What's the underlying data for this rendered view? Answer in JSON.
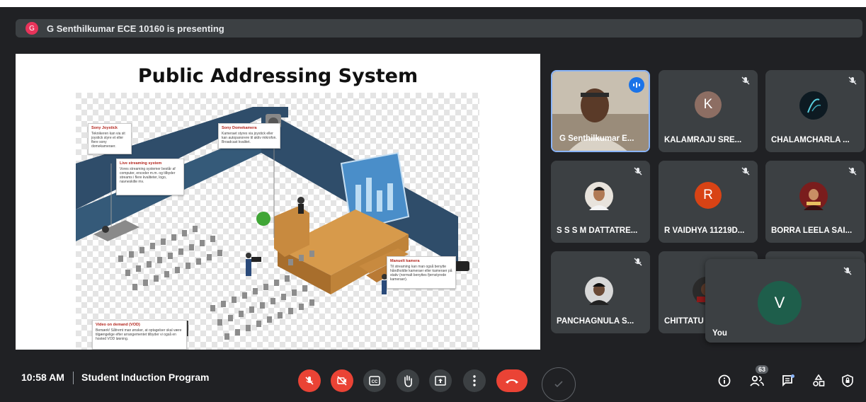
{
  "presenting_banner": {
    "avatar_letter": "G",
    "text": "G Senthilkumar ECE 10160 is presenting"
  },
  "slide": {
    "title": "Public Addressing System",
    "callouts": [
      {
        "title": "Sony Joystick",
        "body": "Teknikeren kan via sit joystick styre et eller flere sony domekameraer."
      },
      {
        "title": "Sony Domekamera",
        "body": "Kameraet styres via joystick eller kan autopanorere til aktiv mikrofon. Broadcast kvalitet."
      },
      {
        "title": "Live streaming system",
        "body": "Vores streaming systemer består af computer, encoder m.m. og tilbyder streams i flere kvaliteter, logo, navneskilte mv."
      },
      {
        "title": "Manuelt kamera",
        "body": "Til streaming kan man også benytte håndholdte kameraer eller kameraer på stativ (normalt benyttes fjernstyrede kameraer)."
      },
      {
        "title": "Video on demand (VOD)",
        "body": "Bemærk! Såfremt man ønsker, at optagelser skal være tilgængelige efter arrangementet tilbyder vi også en hosted VOD løsning."
      }
    ]
  },
  "participants": [
    {
      "name": "G Senthilkumar E...",
      "kind": "video",
      "speaking": true
    },
    {
      "name": "KALAMRAJU SRE...",
      "avatar_letter": "K",
      "avatar_color": "#8d6e63"
    },
    {
      "name": "CHALAMCHARLA ...",
      "kind": "photo"
    },
    {
      "name": "S S S M DATTATRE...",
      "kind": "photo"
    },
    {
      "name": "R VAIDHYA 11219D...",
      "avatar_letter": "R",
      "avatar_color": "#d84315"
    },
    {
      "name": "BORRA LEELA SAI...",
      "kind": "photo"
    },
    {
      "name": "PANCHAGNULA S...",
      "kind": "photo"
    },
    {
      "name": "CHITTATU",
      "kind": "photo"
    }
  ],
  "self_tile": {
    "label": "You",
    "avatar_letter": "V",
    "avatar_color": "#1e5e4b"
  },
  "bottom_bar": {
    "time": "10:58 AM",
    "separator": "|",
    "meeting_name": "Student Induction Program",
    "participant_count": "63",
    "colors": {
      "mic_off": "#ea4335",
      "end_call": "#ea4335",
      "control": "#3c4043"
    }
  }
}
